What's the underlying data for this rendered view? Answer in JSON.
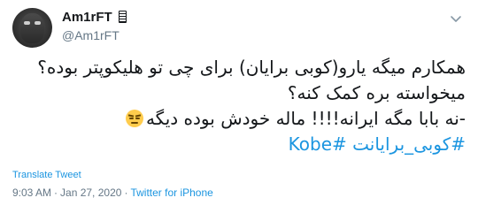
{
  "tweet": {
    "author": {
      "display_name": "Am1rFT",
      "handle": "@Am1rFT"
    },
    "text_lines": [
      "همکارم میگه یارو(کوبی برایان) برای چی تو هلیکوپتر بوده؟",
      "میخواسته بره کمک کنه؟",
      "-نه بابا مگه ایرانه!!!! ماله خودش بوده دیگه"
    ],
    "hashtags": "#کوبی_برایانت #Kobe",
    "emoji": "unamused-face-emoji",
    "translate_label": "Translate Tweet",
    "time": "9:03 AM",
    "separator": "·",
    "date": "Jan 27, 2020",
    "source": "Twitter for iPhone"
  },
  "icons": {
    "avatar": "masked-face-avatar",
    "name_badge": "box-glyph-icon",
    "menu": "chevron-down-icon"
  },
  "colors": {
    "text": "#14171a",
    "muted": "#657786",
    "link": "#1b95e0",
    "emoji": "#ffcc4d"
  }
}
